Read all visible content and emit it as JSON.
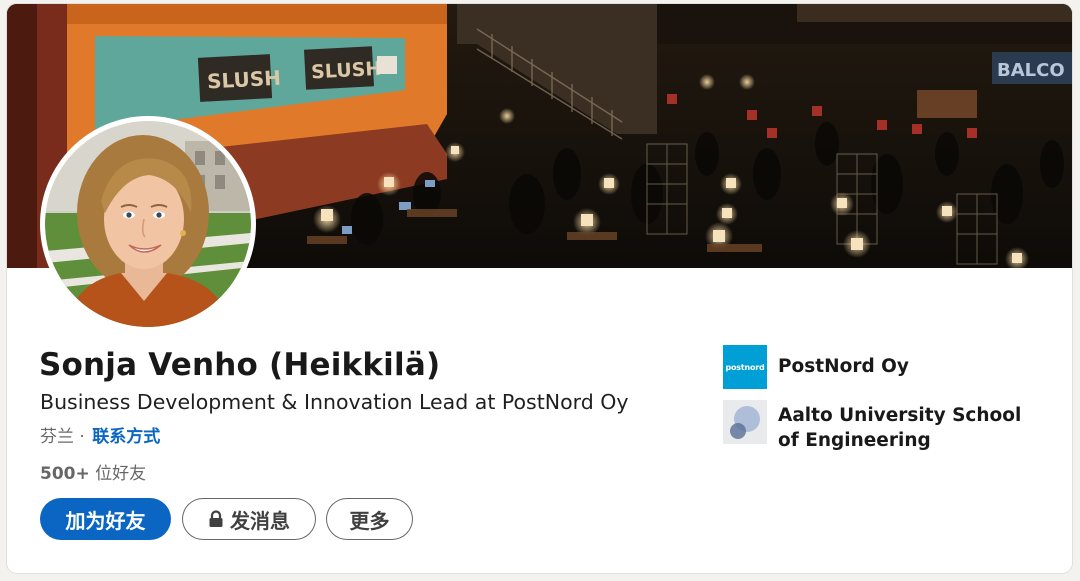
{
  "profile": {
    "name": "Sonja Venho (Heikkilä)",
    "headline": "Business Development & Innovation Lead at PostNord Oy",
    "location": "芬兰 ·",
    "contact_info_label": "联系方式",
    "connections_count": "500+",
    "connections_suffix": "位好友"
  },
  "actions": {
    "connect_label": "加为好友",
    "message_label": "发消息",
    "more_label": "更多"
  },
  "organizations": [
    {
      "name": "PostNord Oy",
      "logo_text": "postnord",
      "logo_color": "#00a0d6"
    },
    {
      "name": "Aalto University School of Engineering",
      "logo_color": "#e9eaec"
    }
  ],
  "cover": {
    "banner_sign_1": "SLUSH",
    "banner_sign_2": "SLUSH",
    "balcony_sign": "BALCO"
  },
  "colors": {
    "accent": "#0a66c2",
    "page_background": "#f3f2ef",
    "card_background": "#ffffff"
  },
  "icons": {
    "message_button_icon": "lock-icon"
  }
}
